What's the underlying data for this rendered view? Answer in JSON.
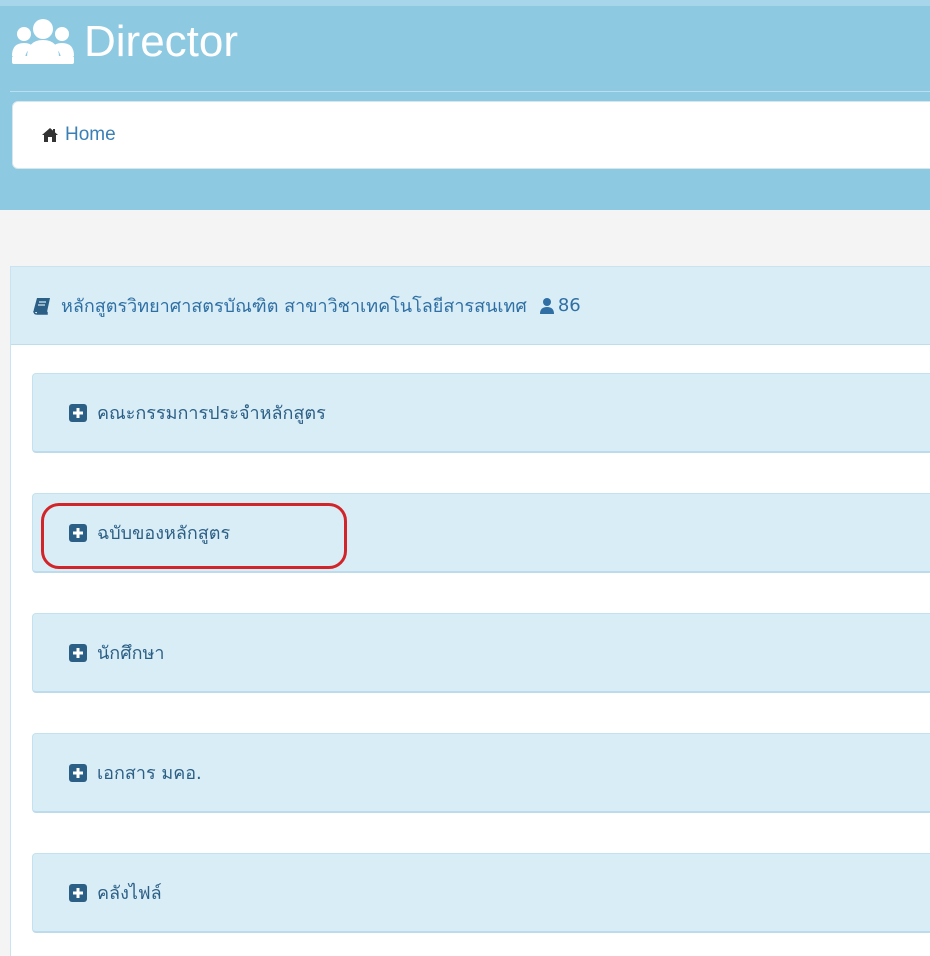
{
  "header": {
    "title": "Director",
    "title_icon": "users-icon",
    "color": "#8ec9e2"
  },
  "breadcrumb": {
    "home_icon": "home-icon",
    "home_label": "Home"
  },
  "panel": {
    "heading_icon": "book-icon",
    "heading": "หลักสูตรวิทยาศาสตรบัณฑิต สาขาวิชาเทคโนโลยีสารสนเทศ",
    "count_icon": "user-icon",
    "count": "86",
    "sections": [
      {
        "icon": "plus-square-icon",
        "label": "คณะกรรมการประจำหลักสูตร"
      },
      {
        "icon": "plus-square-icon",
        "label": "ฉบับของหลักสูตร",
        "highlighted": true
      },
      {
        "icon": "plus-square-icon",
        "label": "นักศึกษา"
      },
      {
        "icon": "plus-square-icon",
        "label": "เอกสาร มคอ."
      },
      {
        "icon": "plus-square-icon",
        "label": "คลังไฟล์"
      }
    ]
  },
  "colors": {
    "panel_bg": "#d9edf7",
    "link": "#3a80b6",
    "highlight": "#d2252a",
    "icon": "#2c5f86"
  }
}
